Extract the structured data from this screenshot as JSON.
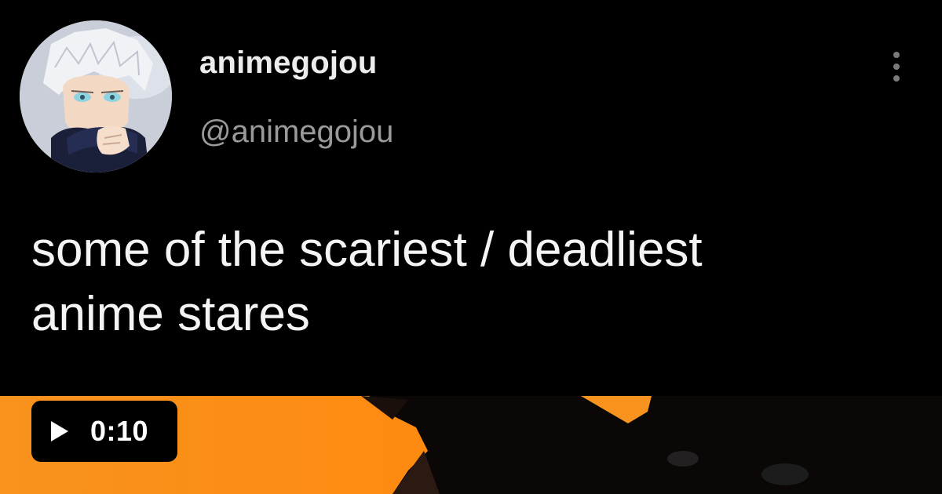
{
  "post": {
    "display_name": "animegojou",
    "handle": "@animegojou",
    "text_line1": "some of the scariest / deadliest",
    "text_line2": "anime stares",
    "avatar_icon": "profile-avatar",
    "menu_icon": "more-vertical-icon"
  },
  "video": {
    "duration": "0:10",
    "play_icon": "play-icon",
    "thumbnail_accent": "#f7931e"
  }
}
